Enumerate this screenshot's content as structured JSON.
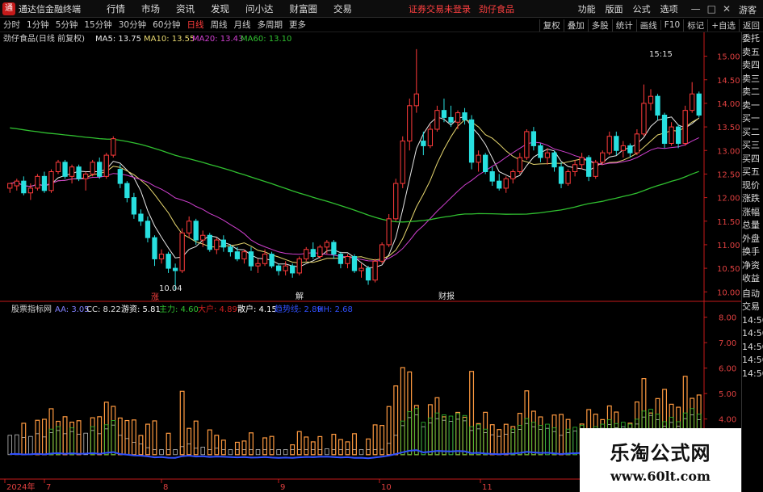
{
  "app": {
    "name": "通达信金融终端",
    "menus": [
      "行情",
      "市场",
      "资讯",
      "发现",
      "问小达",
      "财富圈",
      "交易"
    ],
    "notice": "证券交易未登录",
    "stock_name_top": "劲仔食品",
    "right_menus": [
      "功能",
      "版面",
      "公式",
      "选项"
    ],
    "guest": "游客",
    "window_controls": [
      "—",
      "□",
      "✕"
    ]
  },
  "periods": [
    "分时",
    "1分钟",
    "5分钟",
    "15分钟",
    "30分钟",
    "60分钟",
    "日线",
    "周线",
    "月线",
    "多周期",
    "更多"
  ],
  "active_period": "日线",
  "right_buttons": [
    "复权",
    "叠加",
    "多股",
    "统计",
    "画线",
    "F10",
    "标记",
    "+自选",
    "返回"
  ],
  "side_panel": [
    "委托",
    "卖五",
    "卖四",
    "卖三",
    "卖二",
    "卖一",
    "买一",
    "买二",
    "买三",
    "买四",
    "买五",
    "现价",
    "涨跌",
    "涨幅",
    "总量",
    "外盘",
    "换手",
    "净资",
    "收益",
    "自动",
    "交易",
    "14:50",
    "14:50",
    "14:50",
    "14:50",
    "14:50"
  ],
  "main_legend": {
    "title": "劲仔食品(日线 前复权)",
    "ma": [
      {
        "label": "MA5: 13.75",
        "color": "#e8e8e8"
      },
      {
        "label": "MA10: 13.55",
        "color": "#e8d870"
      },
      {
        "label": "MA20: 13.43",
        "color": "#d040d0"
      },
      {
        "label": "MA60: 13.10",
        "color": "#30c030"
      }
    ]
  },
  "sub_legend": {
    "title": "股票指标网",
    "items": [
      {
        "label": "AA: 3.05",
        "color": "#8080ff"
      },
      {
        "label": "CC: 8.22",
        "color": "#e0e0e0"
      },
      {
        "label": "游资: 5.81",
        "color": "#ffffff"
      },
      {
        "label": "主力: 4.60",
        "color": "#30c030"
      },
      {
        "label": "大户: 4.89",
        "color": "#d02020"
      },
      {
        "label": "散户: 4.15",
        "color": "#ffffff"
      },
      {
        "label": "趋势线: 2.89",
        "color": "#3050ff"
      },
      {
        "label": "HH: 2.68",
        "color": "#3050ff"
      }
    ]
  },
  "annotations": {
    "high": "15:15",
    "low": "10.04",
    "marks": [
      "涨",
      "解",
      "财报"
    ]
  },
  "xaxis": {
    "labels": [
      "2024年",
      "7",
      "8",
      "9",
      "10",
      "11"
    ]
  },
  "colors": {
    "up": "#ff3b3b",
    "down": "#28e0e0",
    "ma5": "#e8e8e8",
    "ma10": "#e8d870",
    "ma20": "#d040d0",
    "ma60": "#30c030",
    "axis": "#c41a1a"
  },
  "watermark": {
    "line1": "乐淘公式网",
    "line2": "www.60lt.com"
  },
  "chart_data": [
    {
      "type": "candlestick",
      "title": "劲仔食品(日线 前复权)",
      "yticks": [
        10.0,
        10.5,
        11.0,
        11.5,
        12.0,
        12.5,
        13.0,
        13.5,
        14.0,
        14.5,
        15.0
      ],
      "ylim": [
        9.85,
        15.25
      ],
      "x_labels": [
        "2024年",
        "7",
        "8",
        "9",
        "10",
        "11"
      ],
      "candles": [
        [
          12.2,
          12.3,
          12.1,
          12.3
        ],
        [
          12.25,
          12.4,
          12.15,
          12.35
        ],
        [
          12.35,
          12.45,
          12.05,
          12.1
        ],
        [
          12.1,
          12.3,
          11.95,
          12.2
        ],
        [
          12.2,
          12.5,
          12.15,
          12.45
        ],
        [
          12.45,
          12.55,
          12.1,
          12.15
        ],
        [
          12.15,
          12.6,
          12.1,
          12.55
        ],
        [
          12.55,
          12.8,
          12.5,
          12.75
        ],
        [
          12.75,
          12.8,
          12.4,
          12.45
        ],
        [
          12.45,
          12.7,
          12.3,
          12.65
        ],
        [
          12.65,
          12.7,
          12.35,
          12.4
        ],
        [
          12.4,
          12.55,
          12.15,
          12.5
        ],
        [
          12.5,
          12.8,
          12.45,
          12.75
        ],
        [
          12.75,
          12.85,
          12.4,
          12.45
        ],
        [
          12.45,
          12.95,
          12.4,
          12.9
        ],
        [
          12.9,
          13.3,
          12.85,
          13.25
        ],
        [
          12.6,
          12.7,
          12.2,
          12.3
        ],
        [
          12.3,
          12.35,
          11.9,
          12.0
        ],
        [
          12.0,
          12.1,
          11.55,
          11.65
        ],
        [
          11.65,
          11.75,
          11.4,
          11.5
        ],
        [
          11.5,
          11.6,
          11.05,
          11.15
        ],
        [
          11.15,
          11.2,
          10.55,
          10.7
        ],
        [
          10.7,
          10.9,
          10.6,
          10.8
        ],
        [
          10.8,
          10.85,
          10.4,
          10.5
        ],
        [
          10.5,
          10.6,
          10.04,
          10.45
        ],
        [
          10.45,
          11.35,
          10.4,
          11.25
        ],
        [
          11.25,
          11.6,
          11.15,
          11.5
        ],
        [
          11.5,
          11.55,
          11.0,
          11.1
        ],
        [
          11.1,
          11.3,
          10.95,
          11.2
        ],
        [
          11.2,
          11.25,
          10.85,
          10.9
        ],
        [
          10.9,
          11.15,
          10.8,
          11.1
        ],
        [
          11.1,
          11.2,
          10.85,
          10.95
        ],
        [
          10.95,
          11.0,
          10.75,
          10.85
        ],
        [
          10.85,
          10.95,
          10.65,
          10.7
        ],
        [
          10.7,
          10.9,
          10.6,
          10.85
        ],
        [
          10.85,
          10.95,
          10.45,
          10.55
        ],
        [
          10.55,
          10.7,
          10.4,
          10.6
        ],
        [
          10.6,
          10.9,
          10.55,
          10.8
        ],
        [
          10.8,
          10.85,
          10.5,
          10.55
        ],
        [
          10.55,
          10.6,
          10.35,
          10.45
        ],
        [
          10.45,
          10.65,
          10.35,
          10.55
        ],
        [
          10.55,
          10.6,
          10.3,
          10.4
        ],
        [
          10.4,
          10.75,
          10.35,
          10.7
        ],
        [
          10.7,
          10.95,
          10.65,
          10.9
        ],
        [
          10.9,
          11.05,
          10.7,
          10.75
        ],
        [
          10.75,
          11.0,
          10.7,
          10.95
        ],
        [
          10.95,
          11.1,
          10.8,
          11.05
        ],
        [
          11.05,
          11.1,
          10.7,
          10.8
        ],
        [
          10.8,
          10.85,
          10.5,
          10.6
        ],
        [
          10.6,
          10.8,
          10.5,
          10.75
        ],
        [
          10.75,
          10.8,
          10.4,
          10.45
        ],
        [
          10.45,
          10.6,
          10.3,
          10.5
        ],
        [
          10.5,
          10.55,
          10.15,
          10.25
        ],
        [
          10.25,
          10.7,
          10.2,
          10.65
        ],
        [
          10.65,
          11.05,
          10.6,
          11.0
        ],
        [
          11.0,
          11.65,
          10.95,
          11.55
        ],
        [
          11.55,
          12.4,
          11.5,
          12.3
        ],
        [
          12.3,
          13.3,
          12.2,
          13.2
        ],
        [
          13.2,
          14.1,
          13.0,
          13.95
        ],
        [
          13.95,
          15.15,
          13.8,
          14.2
        ],
        [
          13.2,
          13.4,
          12.9,
          13.1
        ],
        [
          13.1,
          13.55,
          13.05,
          13.45
        ],
        [
          13.45,
          13.95,
          13.4,
          13.85
        ],
        [
          13.85,
          14.1,
          13.6,
          13.7
        ],
        [
          13.7,
          13.95,
          13.5,
          13.6
        ],
        [
          13.6,
          13.85,
          13.45,
          13.8
        ],
        [
          13.8,
          13.9,
          13.55,
          13.65
        ],
        [
          13.65,
          13.75,
          12.6,
          12.75
        ],
        [
          12.75,
          13.0,
          12.55,
          12.9
        ],
        [
          12.9,
          12.95,
          12.5,
          12.55
        ],
        [
          12.55,
          12.65,
          12.25,
          12.35
        ],
        [
          12.35,
          12.5,
          12.15,
          12.2
        ],
        [
          12.2,
          12.45,
          12.1,
          12.4
        ],
        [
          12.4,
          12.6,
          12.3,
          12.55
        ],
        [
          12.55,
          12.95,
          12.5,
          12.85
        ],
        [
          12.85,
          13.45,
          12.8,
          13.4
        ],
        [
          13.4,
          13.5,
          13.0,
          13.1
        ],
        [
          13.1,
          13.15,
          12.75,
          12.85
        ],
        [
          12.85,
          13.05,
          12.7,
          12.95
        ],
        [
          12.95,
          13.0,
          12.55,
          12.65
        ],
        [
          12.65,
          12.75,
          12.2,
          12.3
        ],
        [
          12.3,
          12.6,
          12.25,
          12.55
        ],
        [
          12.55,
          12.8,
          12.45,
          12.7
        ],
        [
          12.7,
          12.95,
          12.6,
          12.85
        ],
        [
          12.85,
          12.9,
          12.35,
          12.45
        ],
        [
          12.45,
          12.8,
          12.4,
          12.75
        ],
        [
          12.75,
          13.0,
          12.7,
          12.95
        ],
        [
          12.95,
          13.4,
          12.9,
          13.3
        ],
        [
          13.3,
          13.4,
          12.9,
          13.0
        ],
        [
          13.0,
          13.2,
          12.85,
          13.1
        ],
        [
          13.1,
          13.15,
          12.85,
          12.95
        ],
        [
          12.95,
          13.45,
          12.9,
          13.35
        ],
        [
          13.35,
          14.4,
          13.3,
          14.0
        ],
        [
          14.0,
          14.3,
          13.85,
          14.15
        ],
        [
          14.15,
          14.2,
          13.65,
          13.75
        ],
        [
          13.75,
          13.8,
          13.05,
          13.15
        ],
        [
          13.15,
          13.6,
          13.1,
          13.5
        ],
        [
          13.5,
          13.55,
          13.05,
          13.15
        ],
        [
          13.15,
          13.95,
          13.1,
          13.85
        ],
        [
          13.85,
          14.45,
          13.8,
          14.2
        ],
        [
          14.2,
          14.25,
          13.7,
          13.75
        ]
      ]
    },
    {
      "type": "bar",
      "title": "股票指标网",
      "yticks": [
        4.0,
        5.0,
        6.0,
        7.0,
        8.0
      ],
      "ylim": [
        1.8,
        8.4
      ],
      "series": [
        {
          "name": "AA",
          "values": [
            3.05
          ]
        },
        {
          "name": "CC",
          "values": [
            8.22
          ]
        },
        {
          "name": "游资",
          "values": [
            5.81
          ]
        },
        {
          "name": "主力",
          "values": [
            4.6
          ]
        },
        {
          "name": "大户",
          "values": [
            4.89
          ]
        },
        {
          "name": "散户",
          "values": [
            4.15
          ]
        },
        {
          "name": "趋势线",
          "values": [
            2.89
          ]
        },
        {
          "name": "HH",
          "values": [
            2.68
          ]
        }
      ]
    }
  ]
}
